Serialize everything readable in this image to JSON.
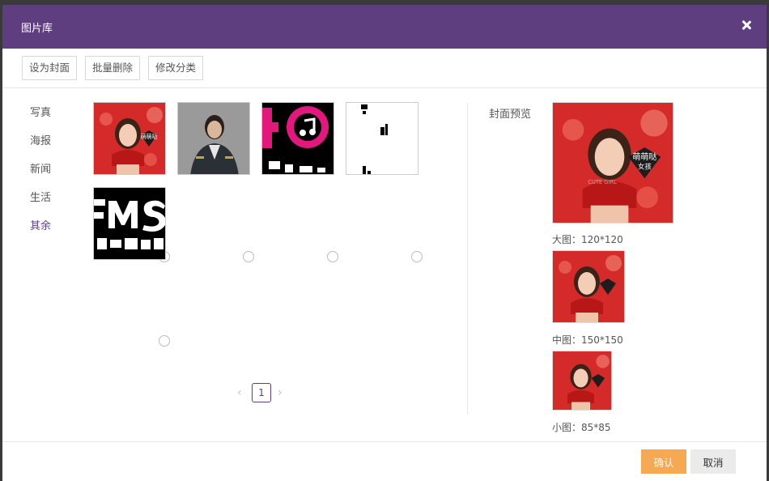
{
  "dialog": {
    "title": "图片库"
  },
  "toolbar": {
    "set_cover": "设为封面",
    "batch_delete": "批量删除",
    "edit_category": "修改分类"
  },
  "categories": [
    {
      "label": "写真"
    },
    {
      "label": "海报"
    },
    {
      "label": "新闻"
    },
    {
      "label": "生活"
    },
    {
      "label": "其余"
    }
  ],
  "pagination": {
    "current": "1"
  },
  "preview": {
    "label": "封面预览",
    "large_caption": "大图：120*120",
    "medium_caption": "中图：150*150",
    "small_caption": "小图：85*85"
  },
  "thumbnail_overlay": {
    "line1": "萌萌哒",
    "line2": "女孩",
    "banner": "CUTE GIRL"
  },
  "footer": {
    "confirm": "确认",
    "cancel": "取消"
  },
  "colors": {
    "header": "#5f3e80",
    "confirm": "#f6a852",
    "active_category": "#5f3e80"
  }
}
